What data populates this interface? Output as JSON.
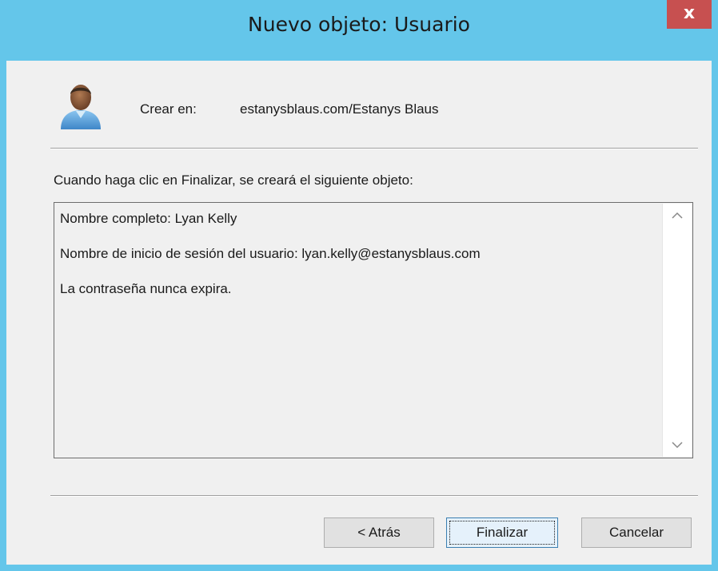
{
  "window": {
    "title": "Nuevo objeto: Usuario",
    "close_label": "x"
  },
  "header": {
    "icon": "user-icon",
    "create_in_label": "Crear en:",
    "create_in_value": "estanysblaus.com/Estanys Blaus"
  },
  "main": {
    "intro": "Cuando haga clic en Finalizar, se creará el siguiente objeto:",
    "summary_lines": [
      "Nombre completo: Lyan Kelly",
      "Nombre de inicio de sesión del usuario: lyan.kelly@estanysblaus.com",
      "La contraseña nunca expira."
    ]
  },
  "buttons": {
    "back": "< Atrás",
    "finish": "Finalizar",
    "cancel": "Cancelar"
  },
  "colors": {
    "titlebar": "#64c6ea",
    "close": "#c75050",
    "dialog_bg": "#f0f0f0"
  }
}
